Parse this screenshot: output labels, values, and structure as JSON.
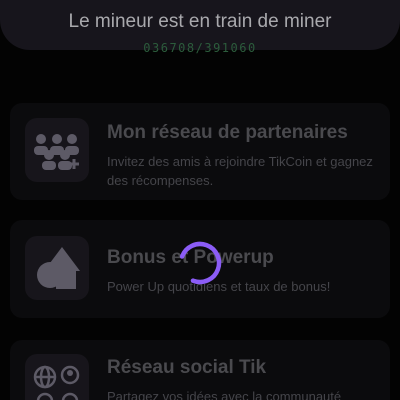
{
  "mining": {
    "status": "Le mineur est en train de miner",
    "counter": "036708/391060"
  },
  "cards": [
    {
      "title": "Mon réseau de partenaires",
      "description": "Invitez des amis à rejoindre TikCoin et gagnez des récompenses.",
      "icon": "team-network-icon"
    },
    {
      "title": "Bonus et Powerup",
      "description": "Power Up quotidiens et taux de bonus!",
      "icon": "shapes-icon"
    },
    {
      "title": "Réseau social Tik",
      "description": "Partagez vos idées avec la communauté",
      "icon": "social-network-icon"
    }
  ],
  "colors": {
    "accent": "#8b5cf6",
    "counter_green": "#2c5c3c",
    "card_bg": "#0b0b0d"
  }
}
